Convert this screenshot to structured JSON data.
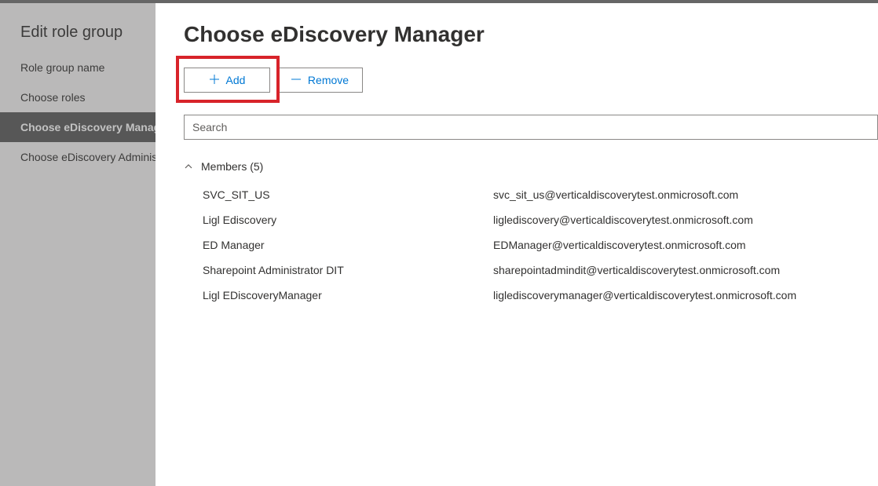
{
  "sidebar": {
    "title": "Edit role group",
    "items": [
      {
        "label": "Role group name",
        "active": false
      },
      {
        "label": "Choose roles",
        "active": false
      },
      {
        "label": "Choose eDiscovery Manager",
        "active": true
      },
      {
        "label": "Choose eDiscovery Administrator",
        "active": false
      }
    ]
  },
  "main": {
    "title": "Choose eDiscovery Manager",
    "toolbar": {
      "add_label": "Add",
      "remove_label": "Remove"
    },
    "search": {
      "placeholder": "Search",
      "value": ""
    },
    "members_header": "Members (5)",
    "members": [
      {
        "name": "SVC_SIT_US",
        "email": "svc_sit_us@verticaldiscoverytest.onmicrosoft.com"
      },
      {
        "name": "Ligl Ediscovery",
        "email": "liglediscovery@verticaldiscoverytest.onmicrosoft.com"
      },
      {
        "name": "ED Manager",
        "email": "EDManager@verticaldiscoverytest.onmicrosoft.com"
      },
      {
        "name": "Sharepoint Administrator DIT",
        "email": "sharepointadmindit@verticaldiscoverytest.onmicrosoft.com"
      },
      {
        "name": "Ligl EDiscoveryManager",
        "email": "liglediscoverymanager@verticaldiscoverytest.onmicrosoft.com"
      }
    ]
  }
}
